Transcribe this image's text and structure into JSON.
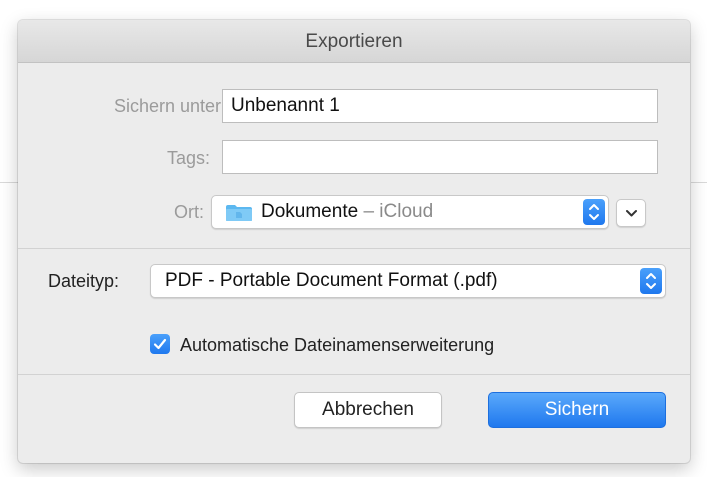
{
  "dialog": {
    "title": "Exportieren",
    "save_as": {
      "label": "Sichern unter:",
      "value": "Unbenannt 1"
    },
    "tags": {
      "label": "Tags:",
      "value": ""
    },
    "location": {
      "label": "Ort:",
      "folder": "Dokumente",
      "separator": " – ",
      "service": "iCloud"
    },
    "filetype": {
      "label": "Dateityp:",
      "value": "PDF - Portable Document Format (.pdf)"
    },
    "extension_checkbox": {
      "label": "Automatische Dateinamenserweiterung",
      "checked": true
    },
    "buttons": {
      "cancel": "Abbrechen",
      "save": "Sichern"
    }
  },
  "colors": {
    "accent": "#1f78ee",
    "panel": "#ececec",
    "label": "#9b9b9b"
  },
  "icons": [
    "folder-icon",
    "stepper-icon",
    "chevron-down-icon",
    "checkmark-icon"
  ]
}
